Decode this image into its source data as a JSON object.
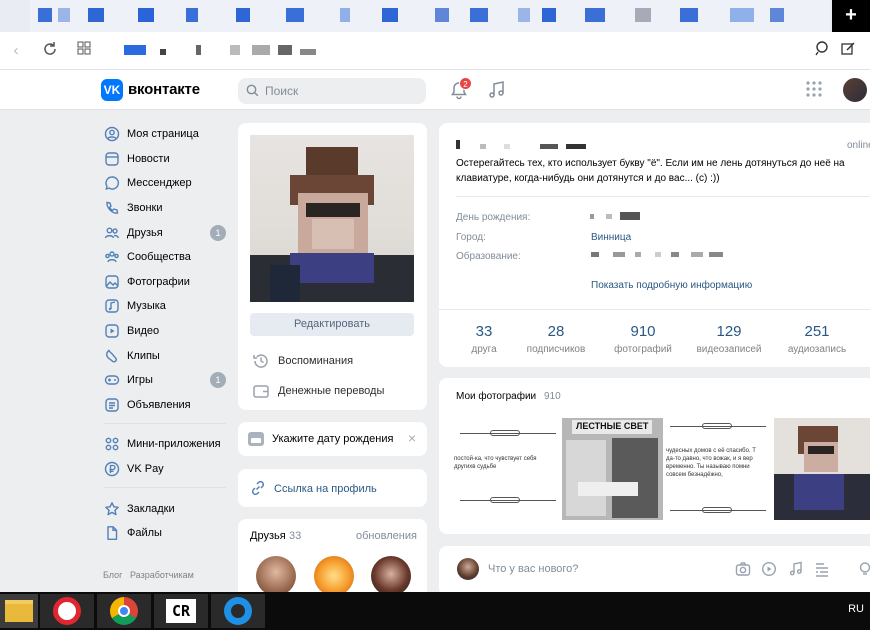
{
  "header": {
    "logo_glyph": "VK",
    "brand": "вконтакте",
    "search_placeholder": "Поиск",
    "notifications_count": "2"
  },
  "menu": {
    "items": [
      {
        "label": "Моя страница",
        "icon": "user-circle-icon"
      },
      {
        "label": "Новости",
        "icon": "newspaper-icon"
      },
      {
        "label": "Мессенджер",
        "icon": "message-icon"
      },
      {
        "label": "Звонки",
        "icon": "phone-icon"
      },
      {
        "label": "Друзья",
        "icon": "users-icon",
        "count": "1"
      },
      {
        "label": "Сообщества",
        "icon": "communities-icon"
      },
      {
        "label": "Фотографии",
        "icon": "image-icon"
      },
      {
        "label": "Музыка",
        "icon": "music-icon"
      },
      {
        "label": "Видео",
        "icon": "video-icon"
      },
      {
        "label": "Клипы",
        "icon": "clips-icon"
      },
      {
        "label": "Игры",
        "icon": "gamepad-icon",
        "count": "1"
      },
      {
        "label": "Объявления",
        "icon": "ads-icon"
      }
    ],
    "items2": [
      {
        "label": "Мини-приложения",
        "icon": "grid-icon"
      },
      {
        "label": "VK Pay",
        "icon": "ruble-icon"
      }
    ],
    "items3": [
      {
        "label": "Закладки",
        "icon": "star-icon"
      },
      {
        "label": "Файлы",
        "icon": "file-icon"
      }
    ],
    "footer": [
      "Блог",
      "Разработчикам"
    ]
  },
  "profile": {
    "edit_button": "Редактировать",
    "memories": "Воспоминания",
    "transfers": "Денежные переводы",
    "birthday_prompt": "Укажите дату рождения",
    "profile_link": "Ссылка на профиль",
    "friends_title": "Друзья",
    "friends_count": "33",
    "friends_updates": "обновления"
  },
  "info": {
    "status_online": "online",
    "status_line1": "Остерегайтесь тех, кто использует букву \"ё\". Если им не лень дотянуться до неё на",
    "status_line2": "клавиатуре, когда-нибудь они дотянутся и до вас... (с) :))",
    "birthday_label": "День рождения:",
    "city_label": "Город:",
    "city_value": "Винница",
    "education_label": "Образование:",
    "more_info": "Показать подробную информацию",
    "counters": [
      {
        "n": "33",
        "t": "друга"
      },
      {
        "n": "28",
        "t": "подписчиков"
      },
      {
        "n": "910",
        "t": "фотографий"
      },
      {
        "n": "129",
        "t": "видеозаписей"
      },
      {
        "n": "251",
        "t": "аудиозапись"
      }
    ]
  },
  "photos": {
    "title": "Мои фотографии",
    "count": "910",
    "thumb1_line1": "постой-ка, что чувствует себя",
    "thumb1_line2": "другихв судьбе",
    "thumb2_title": "ЛЕСТНЫЕ СВЕТ",
    "thumb3_line1": "чудесных домов с её спасибо. Т",
    "thumb3_line2": "да-то давно, что вожак, и я вер",
    "thumb3_line3": "временно. Ты называю помни",
    "thumb3_line4": "совсем безнадёжно,"
  },
  "composer": {
    "placeholder": "Что у вас нового?"
  },
  "taskbar": {
    "lang": "RU",
    "app_cr": "CR"
  }
}
